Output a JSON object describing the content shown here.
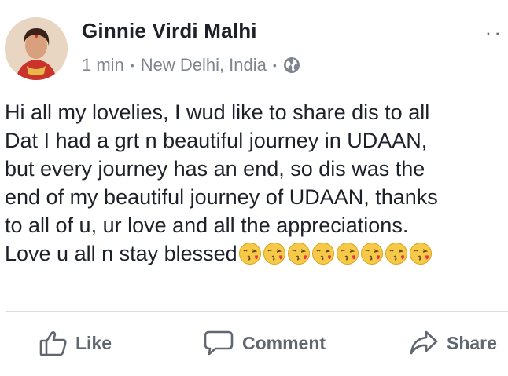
{
  "post": {
    "author": "Ginnie Virdi Malhi",
    "time": "1 min",
    "location": "New Delhi, India",
    "separator": "•",
    "text_lines": [
      "Hi all my lovelies, I wud like to share dis to all",
      "Dat I had a grt n beautiful journey in UDAAN,",
      "but every journey has an end, so dis was the",
      "end of my beautiful journey of UDAAN, thanks",
      "to all of u, ur love and all the appreciations.",
      "Love u all n stay blessed"
    ],
    "emoji_count": 8,
    "emoji_name": "kissing-face-heart-emoji"
  },
  "actions": {
    "like": "Like",
    "comment": "Comment",
    "share": "Share"
  },
  "icons": {
    "globe": "globe-icon",
    "more": "more-options-icon",
    "like": "thumbs-up-icon",
    "comment": "speech-bubble-icon",
    "share": "share-arrow-icon"
  },
  "colors": {
    "name": "#1d2129",
    "meta": "#7f858f",
    "action": "#606770",
    "divider": "#dadde1"
  }
}
